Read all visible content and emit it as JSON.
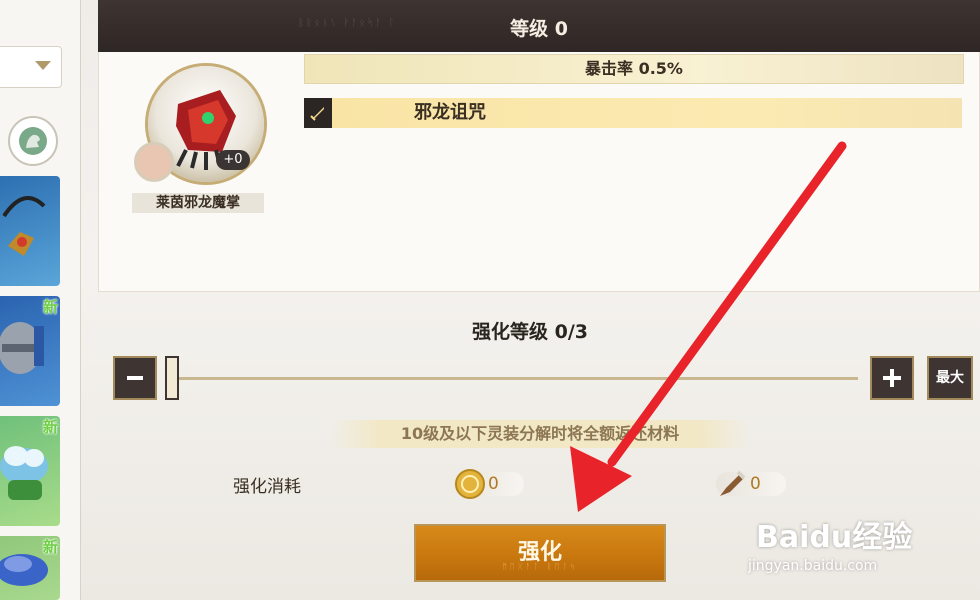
{
  "left_panel": {
    "thumbnails": [
      {
        "new": ""
      },
      {
        "new": "新"
      },
      {
        "new": "新"
      },
      {
        "new": "新"
      }
    ]
  },
  "info_card": {
    "header_code": "ᛒᚱᛟᚾᛊ ᚹᚨᛟᛋᚨ ᛚ",
    "level_text": "等级 0",
    "crit_text": "暴击率  0.5%",
    "skill_name": "邪龙诅咒",
    "enhance_badge": "+0",
    "equip_name": "莱茵邪龙魔掌"
  },
  "enhance": {
    "title": "强化等级  0/3",
    "current": 0,
    "max": 3,
    "max_button": "最大",
    "note": "10级及以下灵装分解时将全额返还材料",
    "cost_label": "强化消耗",
    "coin_cost": "0",
    "horn_cost": "0",
    "button_label": "强化",
    "button_sub": "ᛗᛖᚷᚨᛚ ᚱᛖᛚᛋ"
  },
  "watermark": {
    "brand": "Baidu经验",
    "url": "jingyan.baidu.com"
  },
  "colors": {
    "accent_gold": "#d78a19",
    "dark_frame": "#3e3432",
    "arrow_red": "#e8232a",
    "new_badge": "#6fd046"
  }
}
